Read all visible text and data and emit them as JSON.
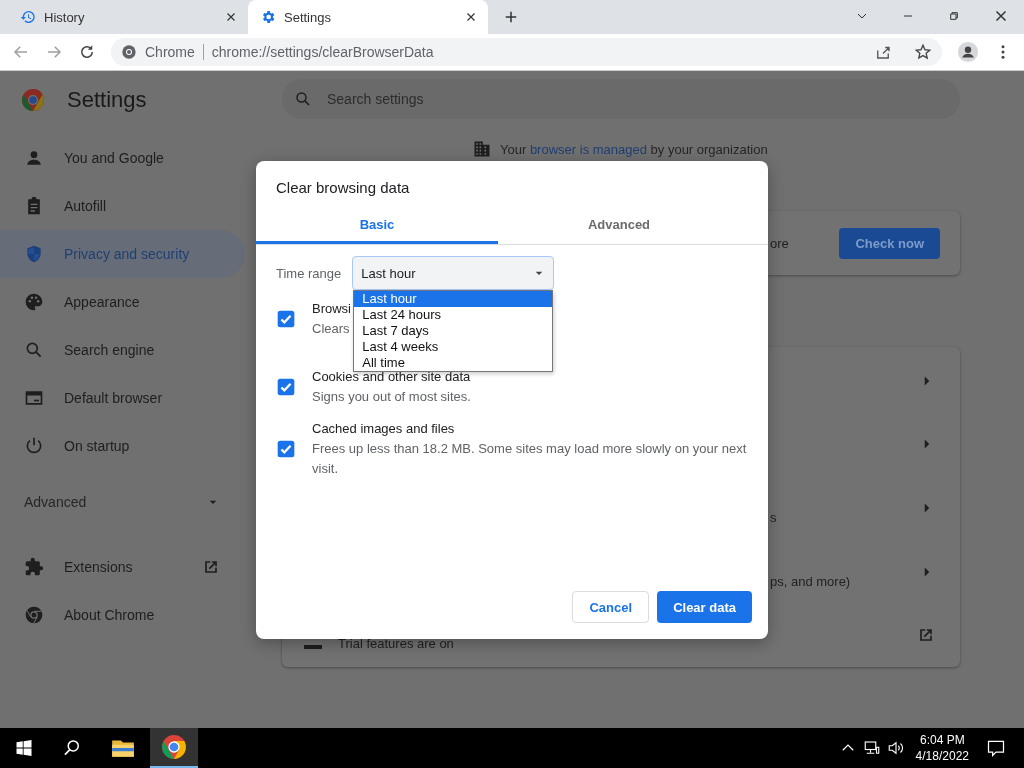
{
  "browser": {
    "tabs": [
      {
        "label": "History",
        "selected": false
      },
      {
        "label": "Settings",
        "selected": true
      }
    ],
    "address": {
      "site_label": "Chrome",
      "url": "chrome://settings/clearBrowserData"
    }
  },
  "settings": {
    "title": "Settings",
    "search_placeholder": "Search settings",
    "sidebar": {
      "items": [
        {
          "label": "You and Google",
          "selected": false
        },
        {
          "label": "Autofill",
          "selected": false
        },
        {
          "label": "Privacy and security",
          "selected": true
        },
        {
          "label": "Appearance",
          "selected": false
        },
        {
          "label": "Search engine",
          "selected": false
        },
        {
          "label": "Default browser",
          "selected": false
        },
        {
          "label": "On startup",
          "selected": false
        }
      ],
      "advanced": {
        "label": "Advanced",
        "expanded": false
      },
      "extras": [
        {
          "label": "Extensions",
          "kind": "external"
        },
        {
          "label": "About Chrome",
          "kind": "plain"
        }
      ]
    },
    "managed_notice": {
      "before": "Your ",
      "link": "browser is managed",
      "after": " by your organization"
    },
    "safety_card": {
      "text": "ore",
      "button": "Check now"
    },
    "privacy_rows": [
      {
        "kind": "arrow"
      },
      {
        "kind": "arrow"
      },
      {
        "kind": "arrow",
        "text": "s"
      },
      {
        "kind": "arrow",
        "text": "ps, and more)"
      },
      {
        "kind": "external",
        "text": "Trial features are on"
      }
    ]
  },
  "dialog": {
    "title": "Clear browsing data",
    "tabs": [
      {
        "label": "Basic",
        "selected": true
      },
      {
        "label": "Advanced",
        "selected": false
      }
    ],
    "time_range": {
      "label": "Time range",
      "value": "Last hour",
      "open": true,
      "options": [
        {
          "label": "Last hour",
          "selected": true
        },
        {
          "label": "Last 24 hours",
          "selected": false
        },
        {
          "label": "Last 7 days",
          "selected": false
        },
        {
          "label": "Last 4 weeks",
          "selected": false
        },
        {
          "label": "All time",
          "selected": false
        }
      ]
    },
    "items": [
      {
        "title": "Browsi",
        "description": "Clears",
        "checked": true
      },
      {
        "title": "Cookies and other site data",
        "description": "Signs you out of most sites.",
        "checked": true
      },
      {
        "title": "Cached images and files",
        "description": "Frees up less than 18.2 MB. Some sites may load more slowly on your next visit.",
        "checked": true
      }
    ],
    "buttons": [
      {
        "label": "Cancel",
        "kind": "secondary"
      },
      {
        "label": "Clear data",
        "kind": "primary"
      }
    ]
  },
  "taskbar": {
    "time": "6:04 PM",
    "date": "4/18/2022"
  }
}
